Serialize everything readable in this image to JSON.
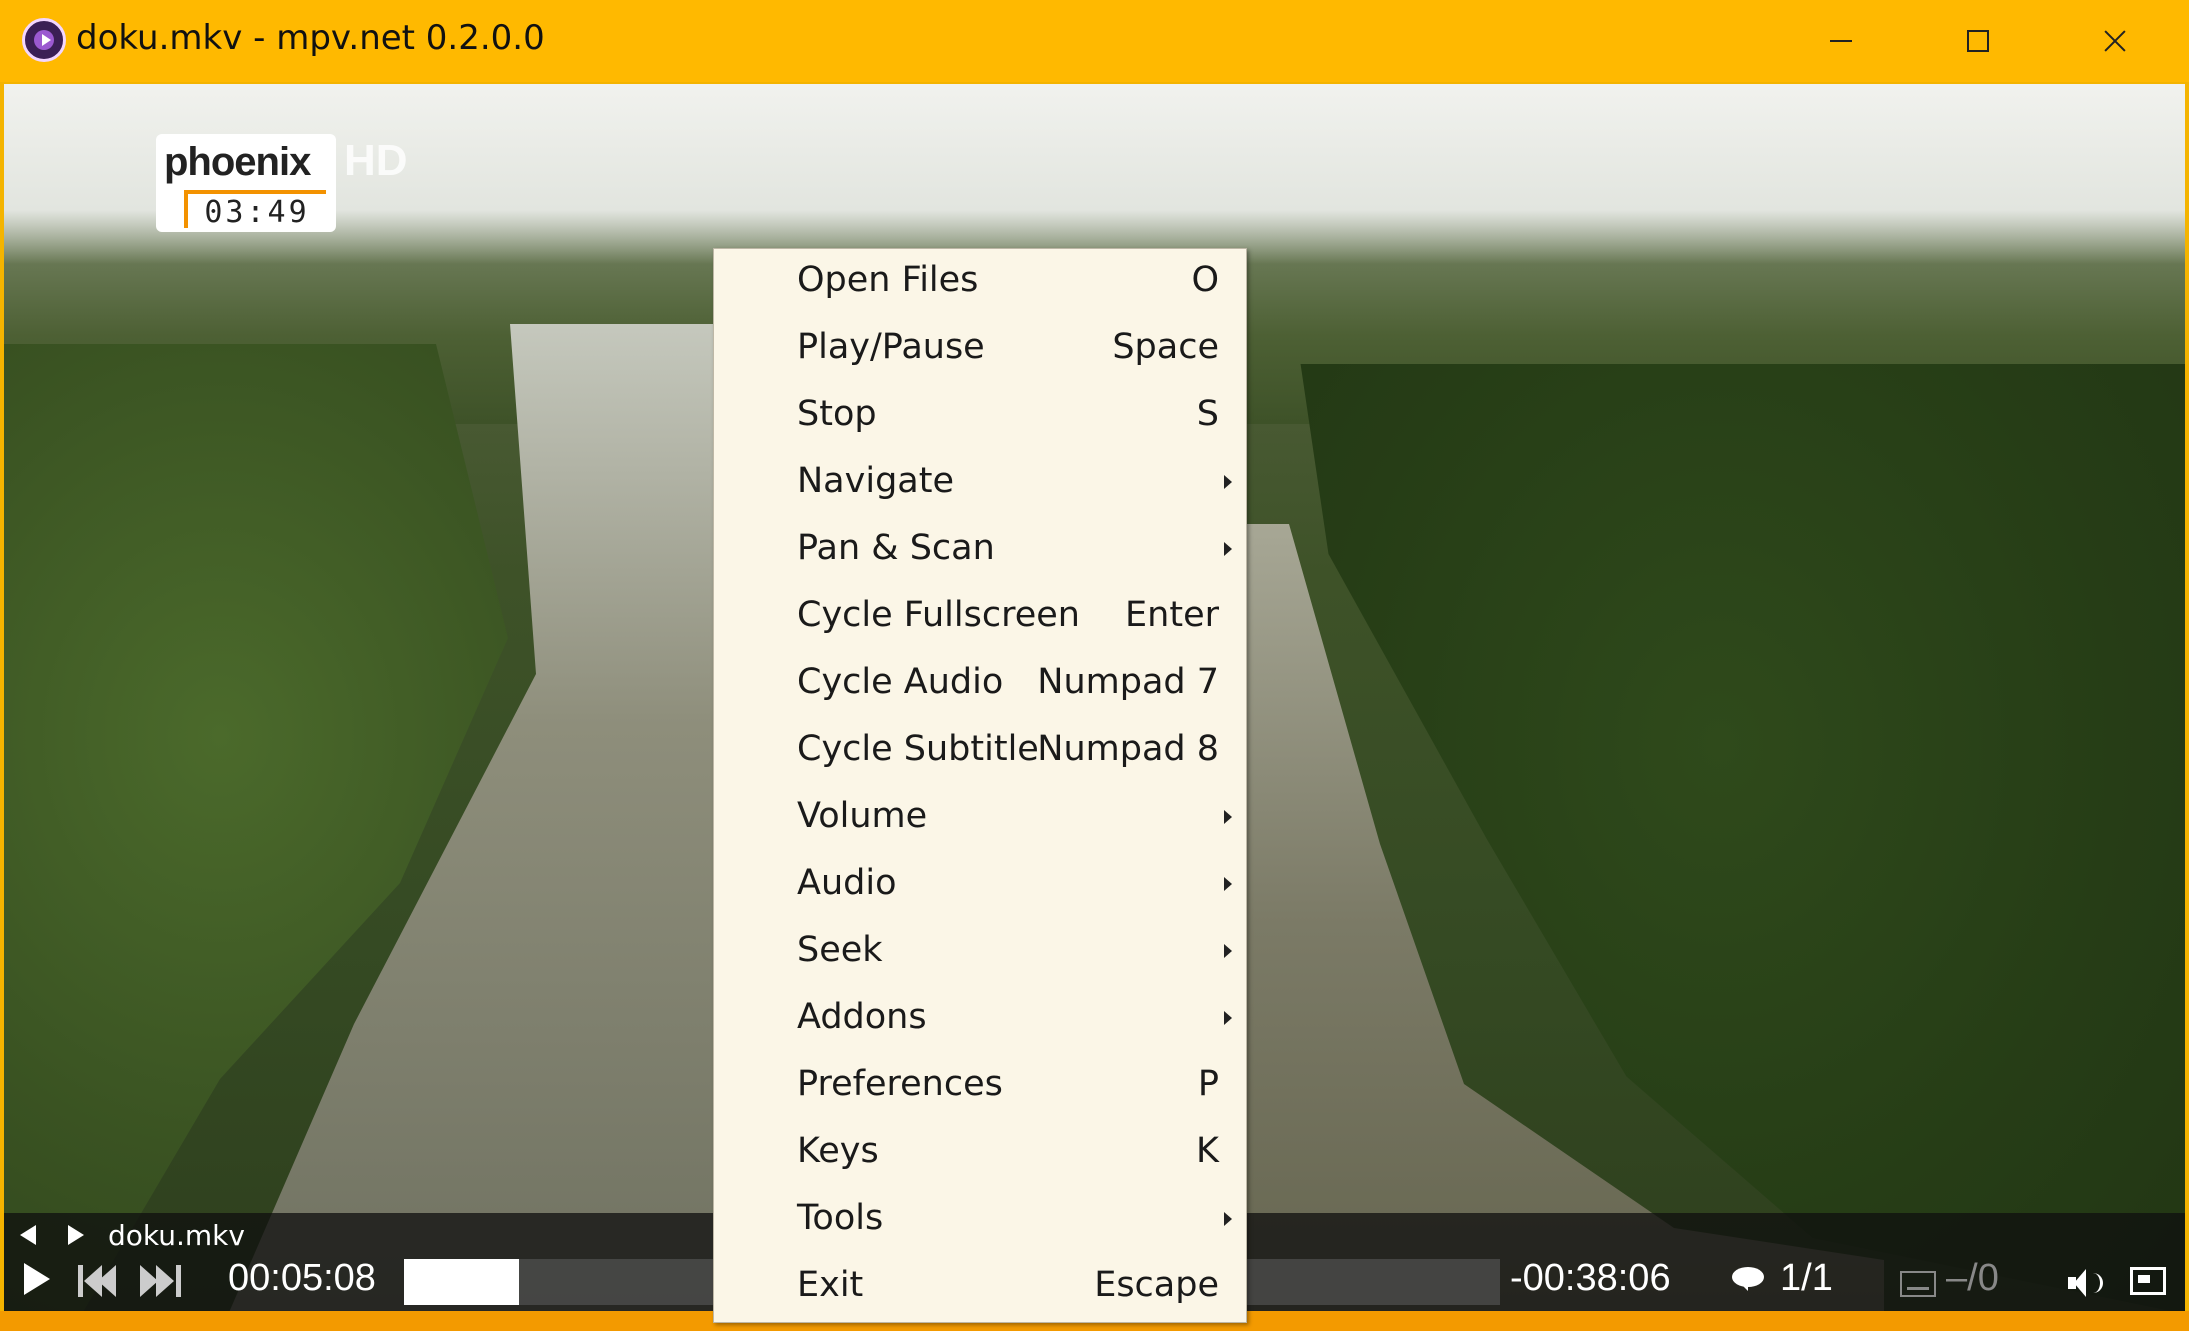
{
  "window": {
    "title": "doku.mkv - mpv.net 0.2.0.0",
    "icon": "mpv-icon",
    "accent": "#ffb900"
  },
  "video": {
    "channel_logo": "phoenix",
    "channel_hd": "HD",
    "channel_clock": "03:49"
  },
  "osc": {
    "filename": "doku.mkv",
    "current_time": "00:05:08",
    "remaining_time": "-00:38:06",
    "audio_track": "1/1",
    "subtitle_track": "–/0",
    "seek_progress": 0.105
  },
  "menu": {
    "items": [
      {
        "label": "Open Files",
        "shortcut": "O",
        "submenu": false
      },
      {
        "label": "Play/Pause",
        "shortcut": "Space",
        "submenu": false
      },
      {
        "label": "Stop",
        "shortcut": "S",
        "submenu": false
      },
      {
        "label": "Navigate",
        "shortcut": "",
        "submenu": true
      },
      {
        "label": "Pan & Scan",
        "shortcut": "",
        "submenu": true
      },
      {
        "label": "Cycle Fullscreen",
        "shortcut": "Enter",
        "submenu": false
      },
      {
        "label": "Cycle Audio",
        "shortcut": "Numpad 7",
        "submenu": false
      },
      {
        "label": "Cycle Subtitle",
        "shortcut": "Numpad 8",
        "submenu": false
      },
      {
        "label": "Volume",
        "shortcut": "",
        "submenu": true
      },
      {
        "label": "Audio",
        "shortcut": "",
        "submenu": true
      },
      {
        "label": "Seek",
        "shortcut": "",
        "submenu": true
      },
      {
        "label": "Addons",
        "shortcut": "",
        "submenu": true
      },
      {
        "label": "Preferences",
        "shortcut": "P",
        "submenu": false
      },
      {
        "label": "Keys",
        "shortcut": "K",
        "submenu": false
      },
      {
        "label": "Tools",
        "shortcut": "",
        "submenu": true
      },
      {
        "label": "Exit",
        "shortcut": "Escape",
        "submenu": false
      }
    ]
  }
}
